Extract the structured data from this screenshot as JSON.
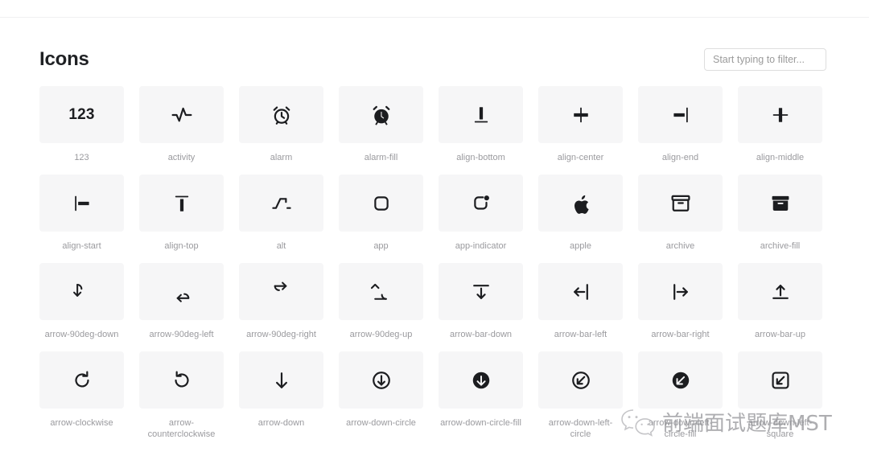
{
  "page": {
    "title": "Icons"
  },
  "search": {
    "placeholder": "Start typing to filter...",
    "value": ""
  },
  "watermark": {
    "text": "前端面试题库MST",
    "logo": "wechat-icon"
  },
  "icons": [
    {
      "name": "123",
      "label": "123",
      "glyph": "123"
    },
    {
      "name": "activity",
      "label": "activity",
      "glyph": "activity"
    },
    {
      "name": "alarm",
      "label": "alarm",
      "glyph": "alarm"
    },
    {
      "name": "alarm-fill",
      "label": "alarm-fill",
      "glyph": "alarm-fill"
    },
    {
      "name": "align-bottom",
      "label": "align-bottom",
      "glyph": "align-bottom"
    },
    {
      "name": "align-center",
      "label": "align-center",
      "glyph": "align-center"
    },
    {
      "name": "align-end",
      "label": "align-end",
      "glyph": "align-end"
    },
    {
      "name": "align-middle",
      "label": "align-middle",
      "glyph": "align-middle"
    },
    {
      "name": "align-start",
      "label": "align-start",
      "glyph": "align-start"
    },
    {
      "name": "align-top",
      "label": "align-top",
      "glyph": "align-top"
    },
    {
      "name": "alt",
      "label": "alt",
      "glyph": "alt"
    },
    {
      "name": "app",
      "label": "app",
      "glyph": "app"
    },
    {
      "name": "app-indicator",
      "label": "app-indicator",
      "glyph": "app-indicator"
    },
    {
      "name": "apple",
      "label": "apple",
      "glyph": "apple"
    },
    {
      "name": "archive",
      "label": "archive",
      "glyph": "archive"
    },
    {
      "name": "archive-fill",
      "label": "archive-fill",
      "glyph": "archive-fill"
    },
    {
      "name": "arrow-90deg-down",
      "label": "arrow-90deg-down",
      "glyph": "arrow-90deg-down"
    },
    {
      "name": "arrow-90deg-left",
      "label": "arrow-90deg-left",
      "glyph": "arrow-90deg-left"
    },
    {
      "name": "arrow-90deg-right",
      "label": "arrow-90deg-right",
      "glyph": "arrow-90deg-right"
    },
    {
      "name": "arrow-90deg-up",
      "label": "arrow-90deg-up",
      "glyph": "arrow-90deg-up"
    },
    {
      "name": "arrow-bar-down",
      "label": "arrow-bar-down",
      "glyph": "arrow-bar-down"
    },
    {
      "name": "arrow-bar-left",
      "label": "arrow-bar-left",
      "glyph": "arrow-bar-left"
    },
    {
      "name": "arrow-bar-right",
      "label": "arrow-bar-right",
      "glyph": "arrow-bar-right"
    },
    {
      "name": "arrow-bar-up",
      "label": "arrow-bar-up",
      "glyph": "arrow-bar-up"
    },
    {
      "name": "arrow-clockwise",
      "label": "arrow-clockwise",
      "glyph": "arrow-clockwise"
    },
    {
      "name": "arrow-counterclockwise",
      "label": "arrow-counterclockwise",
      "glyph": "arrow-counterclockwise"
    },
    {
      "name": "arrow-down",
      "label": "arrow-down",
      "glyph": "arrow-down"
    },
    {
      "name": "arrow-down-circle",
      "label": "arrow-down-circle",
      "glyph": "arrow-down-circle"
    },
    {
      "name": "arrow-down-circle-fill",
      "label": "arrow-down-circle-fill",
      "glyph": "arrow-down-circle-fill"
    },
    {
      "name": "arrow-down-left-circle",
      "label": "arrow-down-left-circle",
      "glyph": "arrow-down-left-circle"
    },
    {
      "name": "arrow-down-left-circle-fill",
      "label": "arrow-down-left-circle-fill",
      "glyph": "arrow-down-left-circle-fill"
    },
    {
      "name": "arrow-down-left-square",
      "label": "arrow-down-left-square",
      "glyph": "arrow-down-left-square"
    }
  ],
  "colors": {
    "tile_background": "#f6f6f7",
    "page_background": "#ffffff",
    "icon_color": "#1c1d20",
    "label_color": "#9a9a9e",
    "title_color": "#1f2124",
    "input_border": "#dedede",
    "placeholder_color": "#9b9b9b"
  }
}
